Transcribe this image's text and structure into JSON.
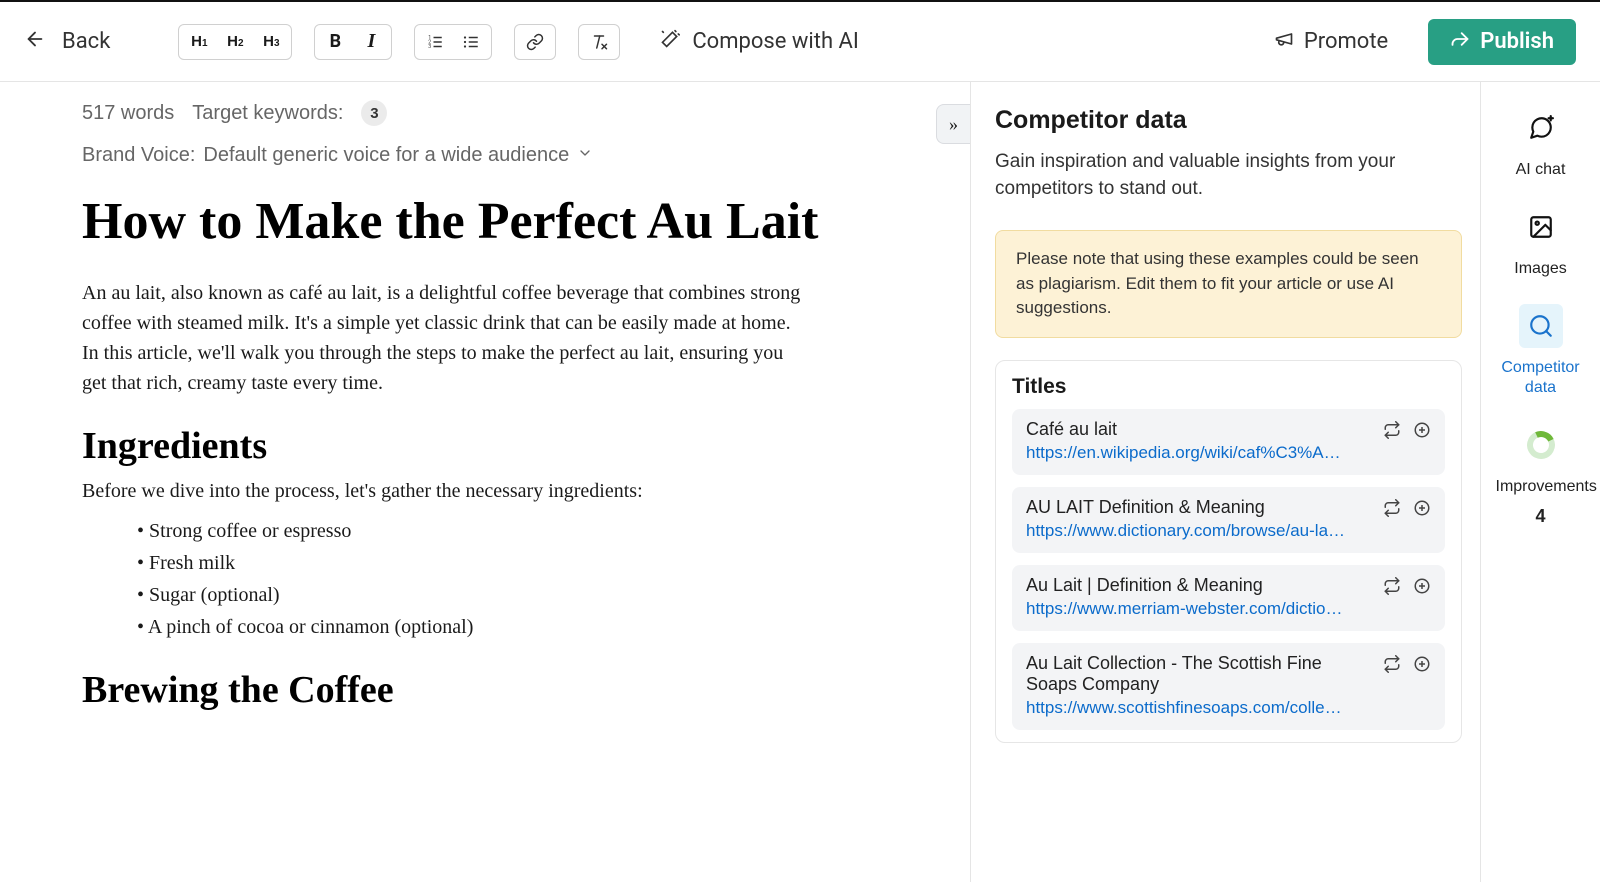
{
  "toolbar": {
    "back": "Back",
    "compose": "Compose with AI",
    "promote": "Promote",
    "publish": "Publish"
  },
  "meta": {
    "word_count": "517 words",
    "keywords_label": "Target keywords:",
    "keywords_count": "3",
    "brand_voice_label": "Brand Voice:",
    "brand_voice_value": "Default generic voice for a wide audience"
  },
  "article": {
    "title": "How to Make the Perfect Au Lait",
    "intro": "An au lait, also known as café au lait, is a delightful coffee beverage that combines strong coffee with steamed milk. It's a simple yet classic drink that can be easily made at home. In this article, we'll walk you through the steps to make the perfect au lait, ensuring you get that rich, creamy taste every time.",
    "h2_ingredients": "Ingredients",
    "ingredients_intro": "Before we dive into the process, let's gather the necessary ingredients:",
    "ingredients": [
      "Strong coffee or espresso",
      "Fresh milk",
      "Sugar (optional)",
      "A pinch of cocoa or cinnamon (optional)"
    ],
    "h2_brewing": "Brewing the Coffee"
  },
  "panel": {
    "title": "Competitor data",
    "description": "Gain inspiration and valuable insights from your competitors to stand out.",
    "notice": "Please note that using these examples could be seen as plagiarism. Edit them to fit your article or use AI suggestions.",
    "section_title": "Titles",
    "items": [
      {
        "title": "Café au lait",
        "url": "https://en.wikipedia.org/wiki/caf%C3%A…"
      },
      {
        "title": "AU LAIT Definition & Meaning",
        "url": "https://www.dictionary.com/browse/au-la…"
      },
      {
        "title": "Au Lait | Definition & Meaning",
        "url": "https://www.merriam-webster.com/dictio…"
      },
      {
        "title": "Au Lait Collection - The Scottish Fine Soaps Company",
        "url": "https://www.scottishfinesoaps.com/colle…"
      }
    ]
  },
  "rail": {
    "ai_chat": "AI chat",
    "images": "Images",
    "competitor": "Competitor data",
    "improvements_label": "Improvements",
    "improvements_count": "4"
  }
}
